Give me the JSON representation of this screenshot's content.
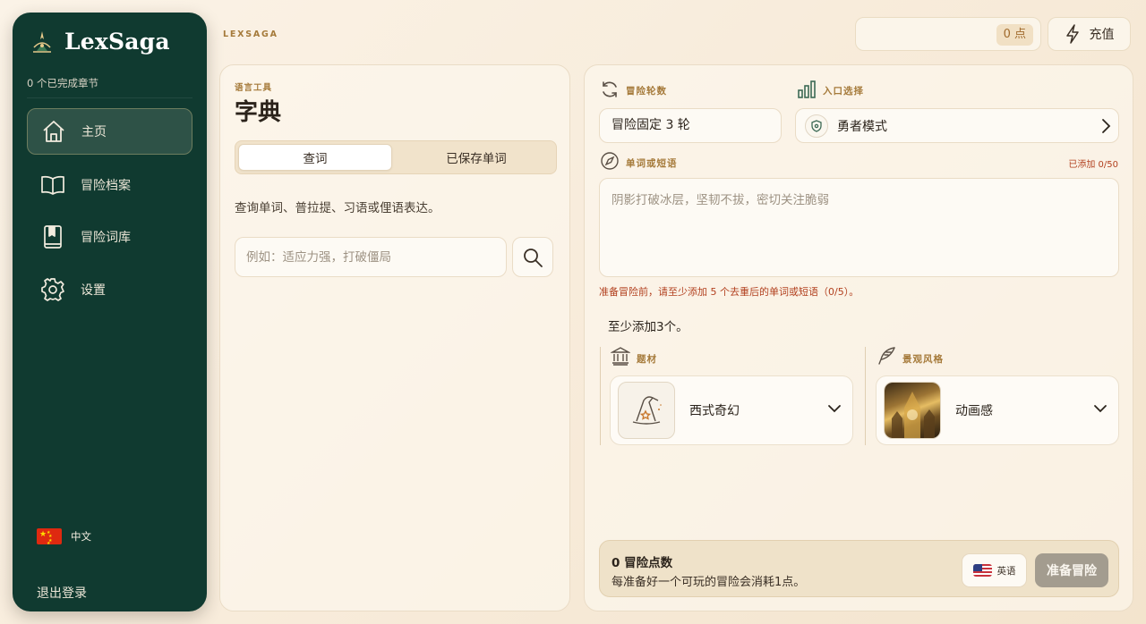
{
  "app": {
    "brand": "LexSaga",
    "header_label": "LEXSAGA"
  },
  "sidebar": {
    "progress": "0 个已完成章节",
    "items": [
      {
        "label": "主页",
        "icon": "home-icon",
        "active": true
      },
      {
        "label": "冒险档案",
        "icon": "book-open-icon"
      },
      {
        "label": "冒险词库",
        "icon": "bookmark-book-icon"
      },
      {
        "label": "设置",
        "icon": "gear-icon"
      }
    ],
    "language": {
      "label": "中文",
      "flag": "china-flag-icon"
    },
    "logout": "退出登录"
  },
  "header": {
    "points_badge": "0 点",
    "recharge": "充值"
  },
  "dictionary": {
    "kicker": "语言工具",
    "title": "字典",
    "tabs": [
      {
        "label": "查词",
        "selected": true
      },
      {
        "label": "已保存单词",
        "selected": false
      }
    ],
    "description": "查询单词、普拉提、习语或俚语表达。",
    "search_placeholder": "例如：适应力强，打破僵局"
  },
  "adventure": {
    "rounds_label": "冒险轮数",
    "rounds_value": "冒险固定 3 轮",
    "entry_label": "入口选择",
    "entry_value": "勇者模式",
    "words_label": "单词或短语",
    "added_count": "已添加 0/50",
    "words_placeholder": "阴影打破冰层，坚韧不拔，密切关注脆弱",
    "warning": "准备冒险前，请至少添加 5 个去重后的单词或短语（0/5）。",
    "min_note": "至少添加3个。",
    "theme_label": "题材",
    "theme_value": "西式奇幻",
    "style_label": "景观风格",
    "style_value": "动画感"
  },
  "footer": {
    "points_title": "0 冒险点数",
    "points_desc": "每准备好一个可玩的冒险会消耗1点。",
    "language": "英语",
    "prepare": "准备冒险"
  },
  "colors": {
    "sidebar_bg": "#103a30",
    "accent_gold": "#a57a3a",
    "warning_red": "#b2401f",
    "disabled_button": "#a39c8f"
  }
}
